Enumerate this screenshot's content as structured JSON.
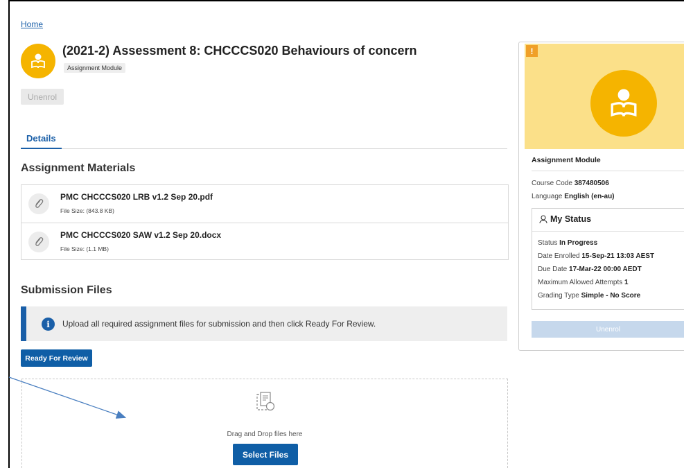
{
  "breadcrumb": {
    "home": "Home"
  },
  "header": {
    "title": "(2021-2) Assessment 8: CHCCCS020 Behaviours of concern",
    "type_chip": "Assignment Module",
    "unenrol_label": "Unenrol",
    "accent_color": "#f5b400"
  },
  "tabs": [
    {
      "label": "Details",
      "active": true
    }
  ],
  "materials": {
    "heading": "Assignment Materials",
    "files": [
      {
        "name": "PMC CHCCCS020 LRB v1.2 Sep 20.pdf",
        "size": "File Size: (843.8 KB)"
      },
      {
        "name": "PMC CHCCCS020 SAW v1.2 Sep 20.docx",
        "size": "File Size: (1.1 MB)"
      }
    ]
  },
  "submission": {
    "heading": "Submission Files",
    "info_text": "Upload all required assignment files for submission and then click Ready For Review.",
    "ready_label": "Ready For Review",
    "drop_text": "Drag and Drop files here",
    "select_label": "Select Files"
  },
  "card": {
    "type": "Assignment Module",
    "course_code_label": "Course Code",
    "course_code": "387480506",
    "language_label": "Language",
    "language": "English (en-au)",
    "status_heading": "My Status",
    "status_label": "Status",
    "status": "In Progress",
    "enrolled_label": "Date Enrolled",
    "enrolled": "15-Sep-21 13:03 AEST",
    "due_label": "Due Date",
    "due": "17-Mar-22 00:00 AEDT",
    "attempts_label": "Maximum Allowed Attempts",
    "attempts": "1",
    "grading_label": "Grading Type",
    "grading": "Simple - No Score",
    "unenrol_label": "Unenrol",
    "alert_glyph": "!"
  },
  "icons": {
    "module": "reader-book-icon",
    "attachment": "paperclip-icon",
    "info": "info-icon",
    "upload": "file-upload-icon",
    "user": "user-icon"
  },
  "colors": {
    "primary": "#0f5ea6",
    "banner": "#fbe089",
    "alert": "#f0a028"
  }
}
